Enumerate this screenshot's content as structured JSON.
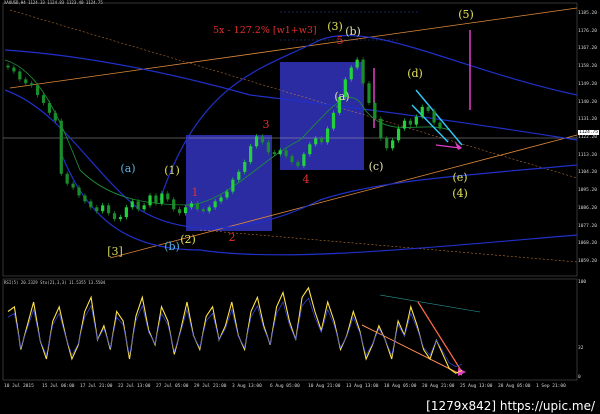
{
  "chart_data": {
    "type": "line",
    "symbol_header": "XAUUSD,H4  1124.33 1124.83 1123.40 1124.75",
    "oscillator_header": "RSI(5) 20.2329   Sto(21,3,3) 11.5355 13.5504",
    "annotation_fib": "5x - 127.2% [w1+w3]",
    "price_ticks": [
      "1185.20",
      "1176.20",
      "1167.20",
      "1158.20",
      "1149.20",
      "1140.20",
      "1131.20",
      "1122.20",
      "1113.20",
      "1104.20",
      "1095.20",
      "1086.20",
      "1077.20",
      "1068.20",
      "1059.20"
    ],
    "current_price": "1124.75",
    "osc_ticks": [
      "100",
      "32",
      "0"
    ],
    "time_ticks": [
      "10 Jul 2015",
      "15 Jul 06:00",
      "17 Jul 21:00",
      "22 Jul 13:00",
      "27 Jul 05:00",
      "29 Jul 21:00",
      "3 Aug 13:00",
      "6 Aug 05:00",
      "10 Aug 21:00",
      "13 Aug 13:00",
      "18 Aug 05:00",
      "20 Aug 21:00",
      "25 Aug 13:00",
      "28 Aug 05:00",
      "1 Sep 21:00"
    ],
    "wave_labels": [
      {
        "text": "[3]",
        "color": "#d6d65a"
      },
      {
        "text": "(a)",
        "color": "#5ab4e6"
      },
      {
        "text": "(b)",
        "color": "#5ab4e6"
      },
      {
        "text": "(1)",
        "color": "#e6e65a"
      },
      {
        "text": "(2)",
        "color": "#e6e65a"
      },
      {
        "text": "1",
        "color": "#e03030"
      },
      {
        "text": "2",
        "color": "#e03030"
      },
      {
        "text": "3",
        "color": "#e03030"
      },
      {
        "text": "4",
        "color": "#e03030"
      },
      {
        "text": "5",
        "color": "#e03030"
      },
      {
        "text": "(3)",
        "color": "#e6e65a"
      },
      {
        "text": "(a)",
        "color": "#e6e6b0"
      },
      {
        "text": "(b)",
        "color": "#e6e6b0"
      },
      {
        "text": "(c)",
        "color": "#e6e6b0"
      },
      {
        "text": "(d)",
        "color": "#e6e65a"
      },
      {
        "text": "(e)",
        "color": "#e6e65a"
      },
      {
        "text": "(4)",
        "color": "#e6e65a"
      },
      {
        "text": "(5)",
        "color": "#e6e65a"
      }
    ],
    "price_close": [
      1158,
      1156,
      1152,
      1150,
      1149,
      1144,
      1140,
      1135,
      1131,
      1104,
      1099,
      1097,
      1093,
      1090,
      1087,
      1085,
      1088,
      1084,
      1081,
      1082,
      1087,
      1090,
      1086,
      1088,
      1093,
      1089,
      1094,
      1091,
      1086,
      1084,
      1087,
      1089,
      1086,
      1085,
      1087,
      1090,
      1092,
      1095,
      1101,
      1105,
      1110,
      1118,
      1123,
      1120,
      1115,
      1114,
      1116,
      1113,
      1110,
      1108,
      1114,
      1119,
      1122,
      1120,
      1127,
      1135,
      1143,
      1152,
      1158,
      1162,
      1150,
      1140,
      1132,
      1122,
      1117,
      1121,
      1127,
      1131,
      1129,
      1133,
      1138,
      1136,
      1130,
      1127
    ],
    "osc_values": [
      70,
      75,
      30,
      55,
      80,
      40,
      20,
      60,
      75,
      45,
      20,
      35,
      70,
      85,
      40,
      55,
      30,
      70,
      60,
      20,
      65,
      85,
      50,
      35,
      75,
      60,
      25,
      50,
      80,
      45,
      30,
      65,
      75,
      40,
      55,
      80,
      45,
      30,
      70,
      85,
      55,
      35,
      75,
      90,
      60,
      40,
      85,
      95,
      70,
      50,
      80,
      60,
      30,
      45,
      70,
      50,
      20,
      35,
      55,
      40,
      20,
      60,
      45,
      75,
      55,
      30,
      20,
      40,
      25,
      10,
      5,
      8
    ]
  },
  "watermark": "[1279x842] https://upic.me/"
}
